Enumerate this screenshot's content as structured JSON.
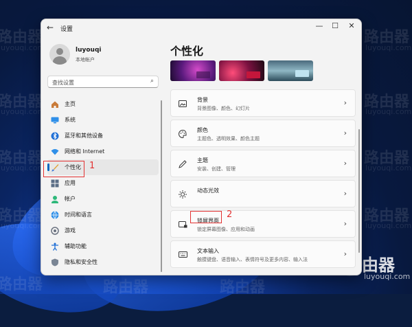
{
  "window": {
    "back_glyph": "←",
    "title": "设置",
    "controls": {
      "minimize": "—",
      "maximize": "☐",
      "close": "✕"
    }
  },
  "account": {
    "name": "luyouqi",
    "type": "本地帐户"
  },
  "search": {
    "placeholder": "查找设置",
    "icon": "search-icon"
  },
  "nav": {
    "items": [
      {
        "label": "主页",
        "icon": "home-icon"
      },
      {
        "label": "系统",
        "icon": "system-icon"
      },
      {
        "label": "蓝牙和其他设备",
        "icon": "bluetooth-icon"
      },
      {
        "label": "网络和 Internet",
        "icon": "wifi-icon"
      },
      {
        "label": "个性化",
        "icon": "brush-icon",
        "selected": true
      },
      {
        "label": "应用",
        "icon": "apps-icon"
      },
      {
        "label": "帐户",
        "icon": "account-icon"
      },
      {
        "label": "时间和语言",
        "icon": "globe-icon"
      },
      {
        "label": "游戏",
        "icon": "gaming-icon"
      },
      {
        "label": "辅助功能",
        "icon": "accessibility-icon"
      },
      {
        "label": "隐私和安全性",
        "icon": "shield-icon"
      }
    ]
  },
  "annotations": {
    "num1": "1",
    "num2": "2"
  },
  "page": {
    "title": "个性化",
    "cards": [
      {
        "title": "背景",
        "desc": "背景图像、颜色、幻灯片",
        "icon": "image-icon"
      },
      {
        "title": "颜色",
        "desc": "主题色、透明效果、颜色主题",
        "icon": "palette-icon"
      },
      {
        "title": "主题",
        "desc": "安装、创建、管理",
        "icon": "pen-icon"
      },
      {
        "title": "动态光效",
        "desc": "",
        "icon": "sun-icon"
      },
      {
        "title": "锁屏界面",
        "desc": "锁定屏幕图像、应用和动画",
        "icon": "lock-screen-icon"
      },
      {
        "title": "文本输入",
        "desc": "触摸键盘、语音输入、表情符号及更多内容、输入法",
        "icon": "keyboard-icon"
      }
    ]
  },
  "watermark": {
    "brand": "路由器",
    "domain": "luyouqi.com"
  },
  "colors": {
    "accent": "#0067c0",
    "annotation": "#e23030"
  }
}
